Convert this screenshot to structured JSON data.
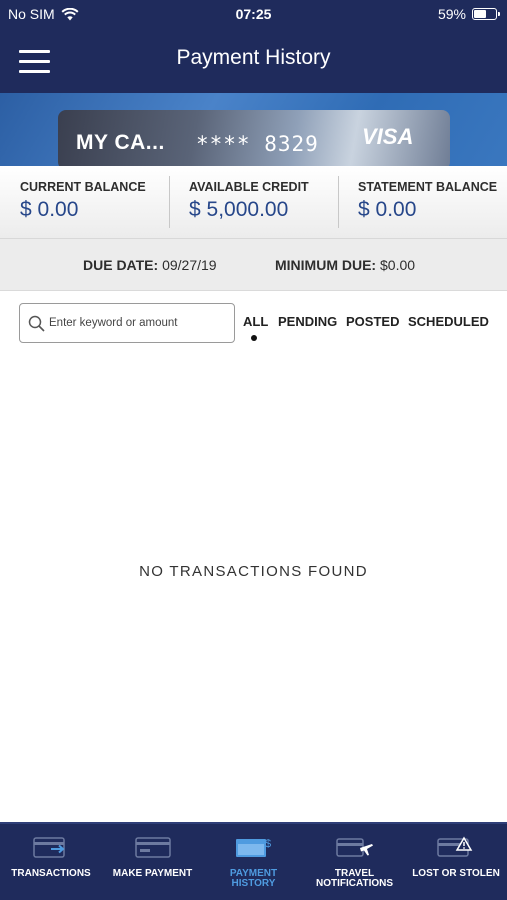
{
  "status_bar": {
    "carrier": "No SIM",
    "time": "07:25",
    "battery": "59%",
    "battery_level": 0.59
  },
  "header": {
    "title": "Payment History",
    "menu_icon": "hamburger-menu-icon"
  },
  "card": {
    "name": "MY CA...",
    "number": "**** 8329",
    "network": "VISA"
  },
  "balances": {
    "current_label": "CURRENT BALANCE",
    "current_value": "$ 0.00",
    "available_label": "AVAILABLE CREDIT",
    "available_value": "$ 5,000.00",
    "statement_label": "STATEMENT BALANCE",
    "statement_value": "$ 0.00"
  },
  "due": {
    "due_date_label": "DUE DATE:",
    "due_date_value": "09/27/19",
    "minimum_label": "MINIMUM DUE:",
    "minimum_value": "$0.00"
  },
  "search": {
    "placeholder": "Enter keyword or amount",
    "value": ""
  },
  "filters": {
    "all": "ALL",
    "pending": "PENDING",
    "posted": "POSTED",
    "scheduled": "SCHEDULED",
    "selected": "ALL"
  },
  "empty_message": "NO TRANSACTIONS FOUND",
  "tabs": {
    "transactions": "TRANSACTIONS",
    "make_payment": "MAKE PAYMENT",
    "payment_history_line1": "PAYMENT",
    "payment_history_line2": "HISTORY",
    "travel_line1": "TRAVEL",
    "travel_line2": "NOTIFICATIONS",
    "lost_stolen": "LOST OR STOLEN",
    "active": "PAYMENT HISTORY"
  },
  "colors": {
    "brand_navy": "#1f2b5c",
    "value_blue": "#27478a",
    "active_tab": "#4f9be0"
  }
}
